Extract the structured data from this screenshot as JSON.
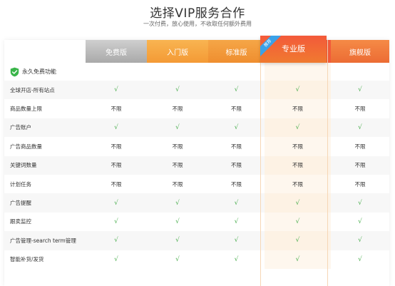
{
  "page": {
    "title": "选择VIP服务合作",
    "subtitle": "一次付费，放心使用，不收取任何额外费用"
  },
  "plans": [
    {
      "name": "免费版",
      "color": "#bdbdbd"
    },
    {
      "name": "入门版",
      "color": "#f6a643"
    },
    {
      "name": "标准版",
      "color": "#f29b3b"
    },
    {
      "name": "专业版",
      "color": "#f25a3a",
      "badge": "推荐"
    },
    {
      "name": "旗舰版",
      "color": "#f07a3c"
    }
  ],
  "section": {
    "title": "永久免费功能",
    "icon": "shield-check-icon"
  },
  "symbols": {
    "check": "√",
    "unlimited": "不限"
  },
  "features": [
    {
      "label": "全球开店-所有站点",
      "values": [
        "√",
        "√",
        "√",
        "√",
        "√"
      ]
    },
    {
      "label": "商品数量上限",
      "values": [
        "不限",
        "不限",
        "不限",
        "不限",
        "不限"
      ]
    },
    {
      "label": "广告账户",
      "values": [
        "√",
        "√",
        "√",
        "√",
        "√"
      ]
    },
    {
      "label": "广告商品数量",
      "values": [
        "不限",
        "不限",
        "不限",
        "不限",
        "不限"
      ]
    },
    {
      "label": "关键词数量",
      "values": [
        "不限",
        "不限",
        "不限",
        "不限",
        "不限"
      ]
    },
    {
      "label": "计划任务",
      "values": [
        "不限",
        "不限",
        "不限",
        "不限",
        "不限"
      ]
    },
    {
      "label": "广告提醒",
      "values": [
        "√",
        "√",
        "√",
        "√",
        "√"
      ]
    },
    {
      "label": "跟卖监控",
      "values": [
        "√",
        "√",
        "√",
        "√",
        "√"
      ]
    },
    {
      "label": "广告管理-search term管理",
      "values": [
        "√",
        "√",
        "√",
        "√",
        "√"
      ]
    },
    {
      "label": "智能补货/发货",
      "values": [
        "√",
        "√",
        "√",
        "√",
        "√"
      ]
    }
  ]
}
